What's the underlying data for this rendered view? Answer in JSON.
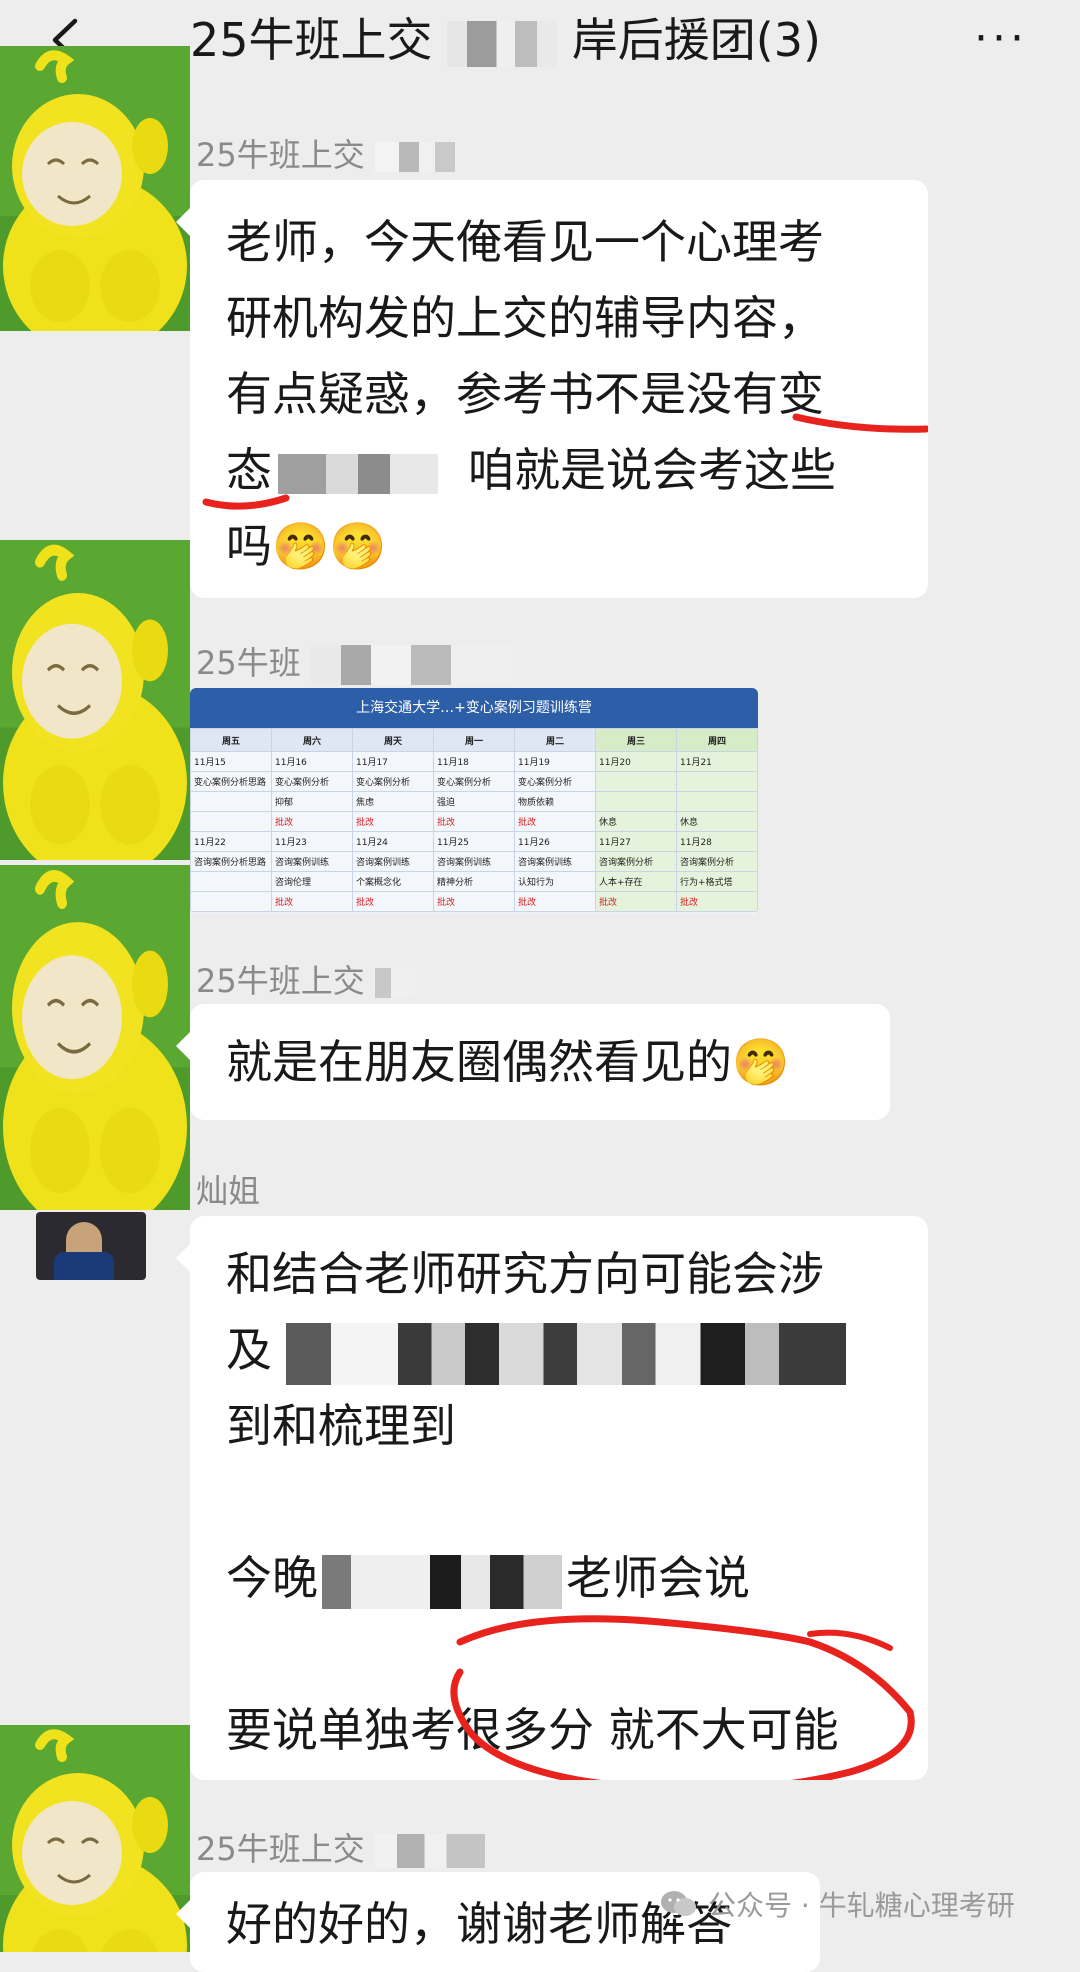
{
  "header": {
    "title": "25牛班上交",
    "title_tail": "岸后援团(3)",
    "back_icon": "chevron-left-icon",
    "more_label": "···"
  },
  "messages": [
    {
      "sender": "25牛班上交",
      "lines": [
        "老师，今天俺看见一个心理考",
        "研机构发的上交的辅导内容，",
        "有点疑惑，参考书不是没有变",
        "态",
        "咱就是说会考这些",
        "吗🤭🤭"
      ]
    },
    {
      "sender": "25牛班"
    },
    {
      "sender": "25牛班上交",
      "lines": [
        "就是在朋友圈偶然看见的🤭"
      ]
    },
    {
      "sender": "灿姐",
      "lines": [
        "和结合老师研究方向可能会涉",
        "及",
        "到和梳理到",
        "今晚",
        "老师会说",
        "要说单独考很多分 就不大可能"
      ]
    },
    {
      "sender": "25牛班上交",
      "lines": [
        "好的好的，谢谢老师解答"
      ]
    }
  ],
  "schedule": {
    "title": "上海交通大学…+变心案例习题训练营",
    "days": [
      "周五",
      "周六",
      "周天",
      "周一",
      "周二",
      "周三",
      "周四"
    ],
    "rows": [
      [
        "11月15",
        "11月16",
        "11月17",
        "11月18",
        "11月19",
        "11月20",
        "11月21"
      ],
      [
        "变心案例分析思路",
        "变心案例分析",
        "变心案例分析",
        "变心案例分析",
        "变心案例分析",
        "",
        ""
      ],
      [
        "",
        "抑郁",
        "焦虑",
        "强迫",
        "物质依赖",
        "",
        ""
      ],
      [
        "",
        "批改",
        "批改",
        "批改",
        "批改",
        "休息",
        "休息"
      ],
      [
        "11月22",
        "11月23",
        "11月24",
        "11月25",
        "11月26",
        "11月27",
        "11月28"
      ],
      [
        "咨询案例分析思路",
        "咨询案例训练",
        "咨询案例训练",
        "咨询案例训练",
        "咨询案例训练",
        "咨询案例分析",
        "咨询案例分析"
      ],
      [
        "",
        "咨询伦理",
        "个案概念化",
        "精神分析",
        "认知行为",
        "人本+存在",
        "行为+格式塔"
      ],
      [
        "",
        "批改",
        "批改",
        "批改",
        "批改",
        "批改",
        "批改"
      ]
    ]
  },
  "watermark": {
    "text": "公众号 · 牛轧糖心理考研",
    "icon": "wechat-icon"
  },
  "colors": {
    "background": "#ededed",
    "bubble": "#ffffff",
    "annotation": "#e8231d",
    "table_header": "#2c5fa8"
  }
}
